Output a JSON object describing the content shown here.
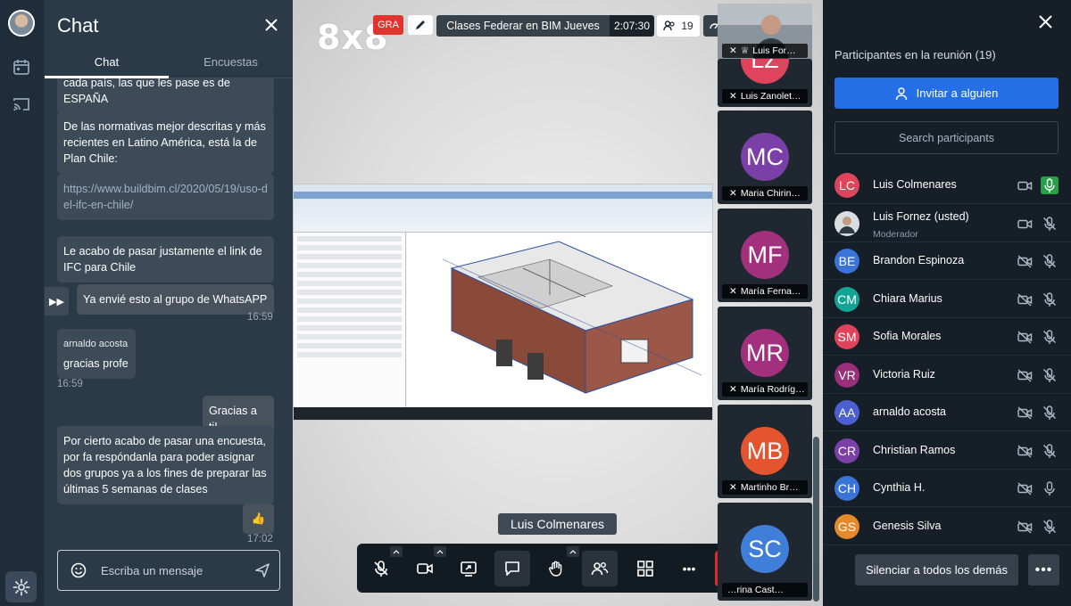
{
  "colors": {
    "accent": "#246fe5",
    "danger": "#dd2b2b",
    "chat_bg": "#2b3a48",
    "panel_bg": "#161f28",
    "mic_active": "#24a148"
  },
  "rail": {
    "icons": [
      "calendar-icon",
      "cast-icon",
      "gear-icon"
    ]
  },
  "chat": {
    "title": "Chat",
    "tabs": [
      {
        "label": "Chat",
        "active": true
      },
      {
        "label": "Encuestas",
        "active": false
      }
    ],
    "messages": [
      {
        "text": "cada país, las que les pase es de ESPAÑA"
      },
      {
        "text": "De las normativas mejor descritas y más recientes en Latino América, está la de Plan Chile:"
      },
      {
        "text": "https://www.buildbim.cl/2020/05/19/uso-del-ifc-en-chile/"
      },
      {
        "text": "Le acabo de pasar justamente el link de IFC para Chile"
      },
      {
        "text": "Ya envié esto al grupo de WhatsAPP",
        "time": "16:59"
      },
      {
        "sender": "arnaldo acosta",
        "text": "gracias profe",
        "time": "16:59"
      },
      {
        "text": "Gracias a ti!"
      },
      {
        "text": "Por cierto acabo de pasar una encuesta, por fa respóndanla para poder asignar dos grupos ya a los fines de preparar las últimas 5 semanas de clases"
      },
      {
        "text": "👍",
        "time": "17:02"
      }
    ],
    "composer_placeholder": "Escriba un mensaje"
  },
  "stage": {
    "logo": "8x8",
    "recording_badge": "GRA",
    "meeting_name": "Clases Federar en BIM Jueves",
    "elapsed": "2:07:30",
    "participant_count": "19",
    "active_speaker": "Luis Colmenares"
  },
  "filmstrip": [
    {
      "name": "Luis For…",
      "initials": "",
      "color": "#5b6b7a",
      "moderator": true
    },
    {
      "name": "Luis Zanolet…",
      "initials": "LZ",
      "color": "#e0445c"
    },
    {
      "name": "Maria Chirin…",
      "initials": "MC",
      "color": "#7b3fa8"
    },
    {
      "name": "María Ferna…",
      "initials": "MF",
      "color": "#a2307d"
    },
    {
      "name": "María Rodríg…",
      "initials": "MR",
      "color": "#a2307d"
    },
    {
      "name": "Martinho Br…",
      "initials": "MB",
      "color": "#e4542e"
    },
    {
      "name": "…rina Cast…",
      "initials": "SC",
      "color": "#3f7fd9"
    }
  ],
  "participants": {
    "title": "Participantes en la reunión (19)",
    "invite_label": "Invitar a alguien",
    "search_placeholder": "Search participants",
    "list": [
      {
        "name": "Luis Colmenares",
        "initials": "LC",
        "color": "#e0445c",
        "camera": "on",
        "mic": "active"
      },
      {
        "name": "Luis Fornez (usted)",
        "role": "Moderador",
        "initials": "",
        "color": "#6d7c8a",
        "camera": "on",
        "mic": "muted"
      },
      {
        "name": "Brandon Espinoza",
        "initials": "BE",
        "color": "#3a74d6",
        "camera": "off",
        "mic": "muted"
      },
      {
        "name": "Chiara Marius",
        "initials": "CM",
        "color": "#12a594",
        "camera": "off",
        "mic": "muted"
      },
      {
        "name": "Sofia Morales",
        "initials": "SM",
        "color": "#e0445c",
        "camera": "off",
        "mic": "muted"
      },
      {
        "name": "Victoria Ruiz",
        "initials": "VR",
        "color": "#9a2f7a",
        "camera": "off",
        "mic": "muted"
      },
      {
        "name": "arnaldo acosta",
        "initials": "AA",
        "color": "#4c5fd0",
        "camera": "off",
        "mic": "muted"
      },
      {
        "name": "Christian Ramos",
        "initials": "CR",
        "color": "#7b3fa8",
        "camera": "off",
        "mic": "muted"
      },
      {
        "name": "Cynthia H.",
        "initials": "CH",
        "color": "#3a74d6",
        "camera": "off",
        "mic": "on"
      },
      {
        "name": "Genesis Silva",
        "initials": "GS",
        "color": "#e58a2a",
        "camera": "off",
        "mic": "muted"
      }
    ],
    "mute_all_label": "Silenciar a todos los demás",
    "more_label": "•••"
  },
  "toolbar": {
    "buttons": [
      "microphone-muted",
      "camera",
      "screen-share",
      "chat",
      "raise-hand",
      "participants",
      "tile-view",
      "more",
      "hang-up"
    ],
    "more_label": "•••"
  }
}
